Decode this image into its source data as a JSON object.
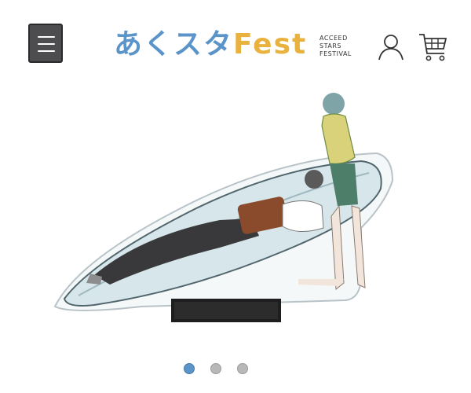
{
  "header": {
    "menu_icon": "hamburger-menu-icon",
    "logo": {
      "main_blue": "あくスタ",
      "main_orange": "Fest",
      "sub_lines": [
        "ACCEED",
        "STARS",
        "FESTIVAL"
      ]
    },
    "account_icon": "user-icon",
    "cart_icon": "shopping-cart-icon"
  },
  "hero": {
    "image_description_icon": "acrylic-stand-illustration"
  },
  "carousel": {
    "slide_count": 3,
    "active_index": 0
  },
  "colors": {
    "logo_blue": "#5b94c8",
    "logo_orange": "#e9b23f",
    "dot_active": "#5b94c8",
    "dot_inactive": "#b8b8b8",
    "menu_bg": "#4d4d4f"
  }
}
